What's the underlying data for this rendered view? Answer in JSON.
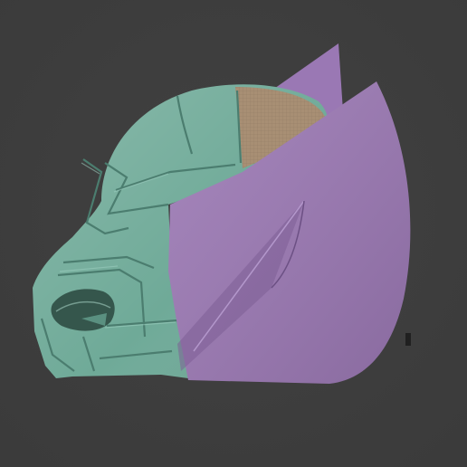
{
  "viewport": {
    "background_color": "#3b3b3b",
    "background_center_color": "#414141"
  },
  "model": {
    "parts": [
      {
        "name": "helmet-shell",
        "color": "#6faa98"
      },
      {
        "name": "crown-cap",
        "color": "#a88f74"
      },
      {
        "name": "rear-fin",
        "color": "#9a78b4"
      },
      {
        "name": "side-wing",
        "color": "#9c79b5"
      },
      {
        "name": "eye-socket",
        "color": "#35564c"
      }
    ]
  }
}
